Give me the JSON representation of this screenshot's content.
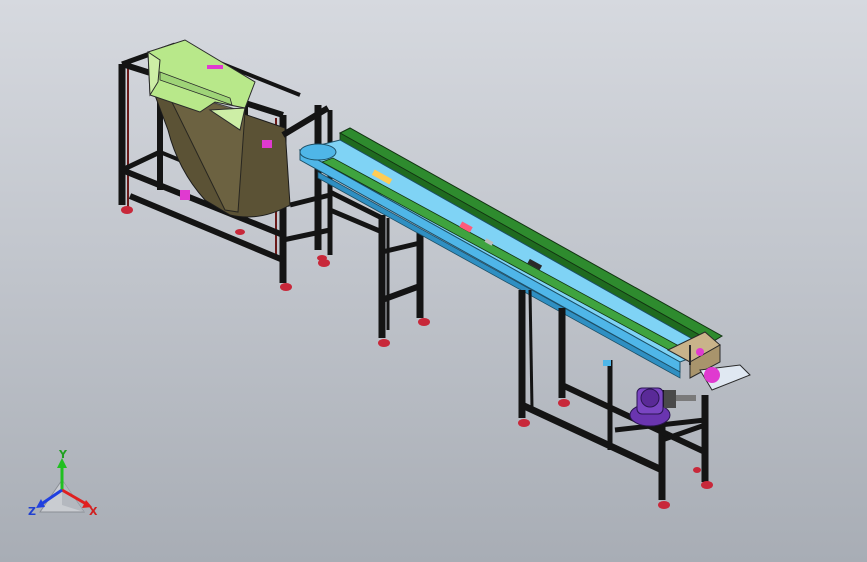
{
  "triad": {
    "x_label": "X",
    "y_label": "Y",
    "z_label": "Z"
  },
  "colors": {
    "background_top": "#d6d9df",
    "background_bottom": "#a8adb5",
    "frame": "#141414",
    "frame_edge": "#5a1414",
    "hopper": "#5b5235",
    "hopper_top": "#b8e88a",
    "conveyor_green": "#2e8b2e",
    "conveyor_blue": "#4fb6e8",
    "conveyor_cyan": "#7fd3f5",
    "motor": "#6a35b0",
    "feet": "#c8283a",
    "accent_magenta": "#e03ad0",
    "axis_x": "#e02020",
    "axis_y": "#20c020",
    "axis_z": "#2040e0"
  }
}
